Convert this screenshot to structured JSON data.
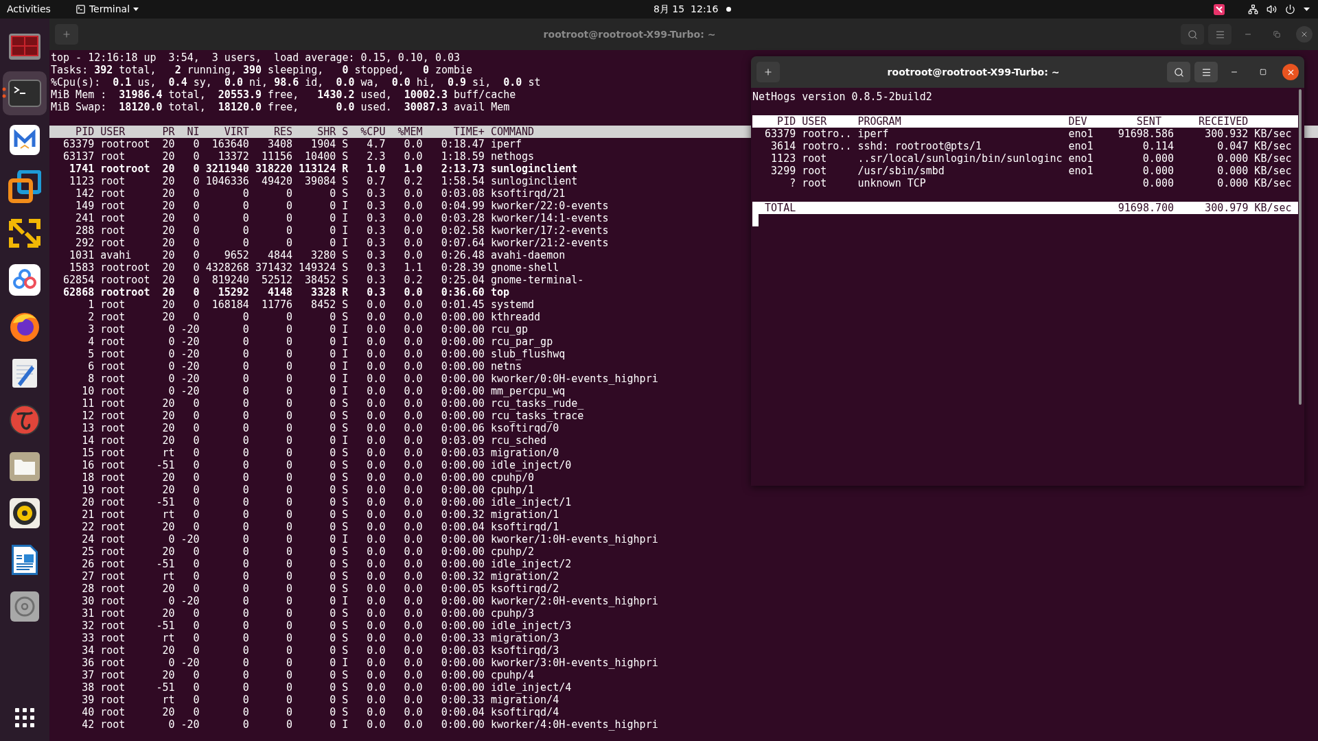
{
  "top_bar": {
    "activities": "Activities",
    "app_menu": "Terminal",
    "clock": "8月 15  12:16"
  },
  "dock": {
    "items": [
      {
        "kind": "workspaces",
        "selected": false,
        "running": false
      },
      {
        "kind": "terminal",
        "selected": true,
        "running": true
      },
      {
        "kind": "mail",
        "selected": false,
        "running": false
      },
      {
        "kind": "boxes",
        "selected": false,
        "running": false
      },
      {
        "kind": "arrows",
        "selected": false,
        "running": false
      },
      {
        "kind": "rings",
        "selected": false,
        "running": false
      },
      {
        "kind": "browser",
        "selected": false,
        "running": false
      },
      {
        "kind": "editor",
        "selected": false,
        "running": false
      },
      {
        "kind": "circle",
        "selected": false,
        "running": false
      },
      {
        "kind": "folder",
        "selected": false,
        "running": false
      },
      {
        "kind": "speaker",
        "selected": false,
        "running": false
      },
      {
        "kind": "document",
        "selected": false,
        "running": false
      },
      {
        "kind": "disc",
        "selected": false,
        "running": false
      }
    ]
  },
  "main_window": {
    "title": "rootroot@rootroot-X99-Turbo: ~",
    "active": false,
    "summary_lines": [
      "top - 12:16:18 up  3:54,  3 users,  load average: 0.15, 0.10, 0.03",
      "Tasks: **392** total,   **2** running, **390** sleeping,   **0** stopped,   **0** zombie",
      "%Cpu(s):  **0.1** us,  **0.4** sy,  **0.0** ni, **98.6** id,  **0.0** wa,  **0.0** hi,  **0.9** si,  **0.0** st",
      "MiB Mem :  **31986.4** total,  **20553.9** free,   **1430.2** used,  **10002.3** buff/cache",
      "MiB Swap:  **18120.0** total,  **18120.0** free,      **0.0** used.  **30087.3** avail Mem"
    ],
    "table": {
      "columns": [
        "PID",
        "USER",
        "PR",
        "NI",
        "VIRT",
        "RES",
        "SHR",
        "S",
        "%CPU",
        "%MEM",
        "TIME+",
        "COMMAND"
      ],
      "rows": [
        {
          "bold": false,
          "cells": [
            "63379",
            "rootroot",
            "20",
            "0",
            "163640",
            "3408",
            "1904",
            "S",
            "4.7",
            "0.0",
            "0:18.47",
            "iperf"
          ]
        },
        {
          "bold": false,
          "cells": [
            "63137",
            "root",
            "20",
            "0",
            "13372",
            "11156",
            "10400",
            "S",
            "2.3",
            "0.0",
            "1:18.59",
            "nethogs"
          ]
        },
        {
          "bold": true,
          "cells": [
            "1741",
            "rootroot",
            "20",
            "0",
            "3211940",
            "318220",
            "113124",
            "R",
            "1.0",
            "1.0",
            "2:13.73",
            "sunloginclient"
          ]
        },
        {
          "bold": false,
          "cells": [
            "1123",
            "root",
            "20",
            "0",
            "1046336",
            "49420",
            "39084",
            "S",
            "0.7",
            "0.2",
            "1:58.54",
            "sunloginclient"
          ]
        },
        {
          "bold": false,
          "cells": [
            "142",
            "root",
            "20",
            "0",
            "0",
            "0",
            "0",
            "S",
            "0.3",
            "0.0",
            "0:03.08",
            "ksoftirqd/21"
          ]
        },
        {
          "bold": false,
          "cells": [
            "149",
            "root",
            "20",
            "0",
            "0",
            "0",
            "0",
            "I",
            "0.3",
            "0.0",
            "0:04.99",
            "kworker/22:0-events"
          ]
        },
        {
          "bold": false,
          "cells": [
            "241",
            "root",
            "20",
            "0",
            "0",
            "0",
            "0",
            "I",
            "0.3",
            "0.0",
            "0:03.28",
            "kworker/14:1-events"
          ]
        },
        {
          "bold": false,
          "cells": [
            "288",
            "root",
            "20",
            "0",
            "0",
            "0",
            "0",
            "I",
            "0.3",
            "0.0",
            "0:02.58",
            "kworker/17:2-events"
          ]
        },
        {
          "bold": false,
          "cells": [
            "292",
            "root",
            "20",
            "0",
            "0",
            "0",
            "0",
            "I",
            "0.3",
            "0.0",
            "0:07.64",
            "kworker/21:2-events"
          ]
        },
        {
          "bold": false,
          "cells": [
            "1031",
            "avahi",
            "20",
            "0",
            "9652",
            "4844",
            "3280",
            "S",
            "0.3",
            "0.0",
            "0:26.48",
            "avahi-daemon"
          ]
        },
        {
          "bold": false,
          "cells": [
            "1583",
            "rootroot",
            "20",
            "0",
            "4328268",
            "371432",
            "149324",
            "S",
            "0.3",
            "1.1",
            "0:28.39",
            "gnome-shell"
          ]
        },
        {
          "bold": false,
          "cells": [
            "62854",
            "rootroot",
            "20",
            "0",
            "819240",
            "52512",
            "38452",
            "S",
            "0.3",
            "0.2",
            "0:25.04",
            "gnome-terminal-"
          ]
        },
        {
          "bold": true,
          "cells": [
            "62868",
            "rootroot",
            "20",
            "0",
            "15292",
            "4148",
            "3328",
            "R",
            "0.3",
            "0.0",
            "0:36.60",
            "top"
          ]
        },
        {
          "bold": false,
          "cells": [
            "1",
            "root",
            "20",
            "0",
            "168184",
            "11776",
            "8452",
            "S",
            "0.0",
            "0.0",
            "0:01.45",
            "systemd"
          ]
        },
        {
          "bold": false,
          "cells": [
            "2",
            "root",
            "20",
            "0",
            "0",
            "0",
            "0",
            "S",
            "0.0",
            "0.0",
            "0:00.00",
            "kthreadd"
          ]
        },
        {
          "bold": false,
          "cells": [
            "3",
            "root",
            "0",
            "-20",
            "0",
            "0",
            "0",
            "I",
            "0.0",
            "0.0",
            "0:00.00",
            "rcu_gp"
          ]
        },
        {
          "bold": false,
          "cells": [
            "4",
            "root",
            "0",
            "-20",
            "0",
            "0",
            "0",
            "I",
            "0.0",
            "0.0",
            "0:00.00",
            "rcu_par_gp"
          ]
        },
        {
          "bold": false,
          "cells": [
            "5",
            "root",
            "0",
            "-20",
            "0",
            "0",
            "0",
            "I",
            "0.0",
            "0.0",
            "0:00.00",
            "slub_flushwq"
          ]
        },
        {
          "bold": false,
          "cells": [
            "6",
            "root",
            "0",
            "-20",
            "0",
            "0",
            "0",
            "I",
            "0.0",
            "0.0",
            "0:00.00",
            "netns"
          ]
        },
        {
          "bold": false,
          "cells": [
            "8",
            "root",
            "0",
            "-20",
            "0",
            "0",
            "0",
            "I",
            "0.0",
            "0.0",
            "0:00.00",
            "kworker/0:0H-events_highpri"
          ]
        },
        {
          "bold": false,
          "cells": [
            "10",
            "root",
            "0",
            "-20",
            "0",
            "0",
            "0",
            "I",
            "0.0",
            "0.0",
            "0:00.00",
            "mm_percpu_wq"
          ]
        },
        {
          "bold": false,
          "cells": [
            "11",
            "root",
            "20",
            "0",
            "0",
            "0",
            "0",
            "S",
            "0.0",
            "0.0",
            "0:00.00",
            "rcu_tasks_rude_"
          ]
        },
        {
          "bold": false,
          "cells": [
            "12",
            "root",
            "20",
            "0",
            "0",
            "0",
            "0",
            "S",
            "0.0",
            "0.0",
            "0:00.00",
            "rcu_tasks_trace"
          ]
        },
        {
          "bold": false,
          "cells": [
            "13",
            "root",
            "20",
            "0",
            "0",
            "0",
            "0",
            "S",
            "0.0",
            "0.0",
            "0:00.06",
            "ksoftirqd/0"
          ]
        },
        {
          "bold": false,
          "cells": [
            "14",
            "root",
            "20",
            "0",
            "0",
            "0",
            "0",
            "I",
            "0.0",
            "0.0",
            "0:03.09",
            "rcu_sched"
          ]
        },
        {
          "bold": false,
          "cells": [
            "15",
            "root",
            "rt",
            "0",
            "0",
            "0",
            "0",
            "S",
            "0.0",
            "0.0",
            "0:00.03",
            "migration/0"
          ]
        },
        {
          "bold": false,
          "cells": [
            "16",
            "root",
            "-51",
            "0",
            "0",
            "0",
            "0",
            "S",
            "0.0",
            "0.0",
            "0:00.00",
            "idle_inject/0"
          ]
        },
        {
          "bold": false,
          "cells": [
            "18",
            "root",
            "20",
            "0",
            "0",
            "0",
            "0",
            "S",
            "0.0",
            "0.0",
            "0:00.00",
            "cpuhp/0"
          ]
        },
        {
          "bold": false,
          "cells": [
            "19",
            "root",
            "20",
            "0",
            "0",
            "0",
            "0",
            "S",
            "0.0",
            "0.0",
            "0:00.00",
            "cpuhp/1"
          ]
        },
        {
          "bold": false,
          "cells": [
            "20",
            "root",
            "-51",
            "0",
            "0",
            "0",
            "0",
            "S",
            "0.0",
            "0.0",
            "0:00.00",
            "idle_inject/1"
          ]
        },
        {
          "bold": false,
          "cells": [
            "21",
            "root",
            "rt",
            "0",
            "0",
            "0",
            "0",
            "S",
            "0.0",
            "0.0",
            "0:00.32",
            "migration/1"
          ]
        },
        {
          "bold": false,
          "cells": [
            "22",
            "root",
            "20",
            "0",
            "0",
            "0",
            "0",
            "S",
            "0.0",
            "0.0",
            "0:00.04",
            "ksoftirqd/1"
          ]
        },
        {
          "bold": false,
          "cells": [
            "24",
            "root",
            "0",
            "-20",
            "0",
            "0",
            "0",
            "I",
            "0.0",
            "0.0",
            "0:00.00",
            "kworker/1:0H-events_highpri"
          ]
        },
        {
          "bold": false,
          "cells": [
            "25",
            "root",
            "20",
            "0",
            "0",
            "0",
            "0",
            "S",
            "0.0",
            "0.0",
            "0:00.00",
            "cpuhp/2"
          ]
        },
        {
          "bold": false,
          "cells": [
            "26",
            "root",
            "-51",
            "0",
            "0",
            "0",
            "0",
            "S",
            "0.0",
            "0.0",
            "0:00.00",
            "idle_inject/2"
          ]
        },
        {
          "bold": false,
          "cells": [
            "27",
            "root",
            "rt",
            "0",
            "0",
            "0",
            "0",
            "S",
            "0.0",
            "0.0",
            "0:00.32",
            "migration/2"
          ]
        },
        {
          "bold": false,
          "cells": [
            "28",
            "root",
            "20",
            "0",
            "0",
            "0",
            "0",
            "S",
            "0.0",
            "0.0",
            "0:00.05",
            "ksoftirqd/2"
          ]
        },
        {
          "bold": false,
          "cells": [
            "30",
            "root",
            "0",
            "-20",
            "0",
            "0",
            "0",
            "I",
            "0.0",
            "0.0",
            "0:00.00",
            "kworker/2:0H-events_highpri"
          ]
        },
        {
          "bold": false,
          "cells": [
            "31",
            "root",
            "20",
            "0",
            "0",
            "0",
            "0",
            "S",
            "0.0",
            "0.0",
            "0:00.00",
            "cpuhp/3"
          ]
        },
        {
          "bold": false,
          "cells": [
            "32",
            "root",
            "-51",
            "0",
            "0",
            "0",
            "0",
            "S",
            "0.0",
            "0.0",
            "0:00.00",
            "idle_inject/3"
          ]
        },
        {
          "bold": false,
          "cells": [
            "33",
            "root",
            "rt",
            "0",
            "0",
            "0",
            "0",
            "S",
            "0.0",
            "0.0",
            "0:00.33",
            "migration/3"
          ]
        },
        {
          "bold": false,
          "cells": [
            "34",
            "root",
            "20",
            "0",
            "0",
            "0",
            "0",
            "S",
            "0.0",
            "0.0",
            "0:00.03",
            "ksoftirqd/3"
          ]
        },
        {
          "bold": false,
          "cells": [
            "36",
            "root",
            "0",
            "-20",
            "0",
            "0",
            "0",
            "I",
            "0.0",
            "0.0",
            "0:00.00",
            "kworker/3:0H-events_highpri"
          ]
        },
        {
          "bold": false,
          "cells": [
            "37",
            "root",
            "20",
            "0",
            "0",
            "0",
            "0",
            "S",
            "0.0",
            "0.0",
            "0:00.00",
            "cpuhp/4"
          ]
        },
        {
          "bold": false,
          "cells": [
            "38",
            "root",
            "-51",
            "0",
            "0",
            "0",
            "0",
            "S",
            "0.0",
            "0.0",
            "0:00.00",
            "idle_inject/4"
          ]
        },
        {
          "bold": false,
          "cells": [
            "39",
            "root",
            "rt",
            "0",
            "0",
            "0",
            "0",
            "S",
            "0.0",
            "0.0",
            "0:00.33",
            "migration/4"
          ]
        },
        {
          "bold": false,
          "cells": [
            "40",
            "root",
            "20",
            "0",
            "0",
            "0",
            "0",
            "S",
            "0.0",
            "0.0",
            "0:00.04",
            "ksoftirqd/4"
          ]
        },
        {
          "bold": false,
          "cells": [
            "42",
            "root",
            "0",
            "-20",
            "0",
            "0",
            "0",
            "I",
            "0.0",
            "0.0",
            "0:00.00",
            "kworker/4:0H-events_highpri"
          ]
        }
      ]
    }
  },
  "nethogs_window": {
    "title": "rootroot@rootroot-X99-Turbo: ~",
    "active": true,
    "version_line": "NetHogs version 0.8.5-2build2",
    "table": {
      "columns": [
        "PID",
        "USER",
        "PROGRAM",
        "DEV",
        "SENT",
        "RECEIVED"
      ],
      "rows": [
        {
          "pid": "63379",
          "user": "rootro..",
          "program": "iperf",
          "dev": "eno1",
          "sent": "91698.586",
          "received": "300.932",
          "unit": "KB/sec"
        },
        {
          "pid": "3614",
          "user": "rootro..",
          "program": "sshd: rootroot@pts/1",
          "dev": "eno1",
          "sent": "0.114",
          "received": "0.047",
          "unit": "KB/sec"
        },
        {
          "pid": "1123",
          "user": "root",
          "program": "..sr/local/sunlogin/bin/sunloginc",
          "dev": "eno1",
          "sent": "0.000",
          "received": "0.000",
          "unit": "KB/sec"
        },
        {
          "pid": "3299",
          "user": "root",
          "program": "/usr/sbin/smbd",
          "dev": "eno1",
          "sent": "0.000",
          "received": "0.000",
          "unit": "KB/sec"
        },
        {
          "pid": "?",
          "user": "root",
          "program": "unknown TCP",
          "sent": "0.000",
          "received": "0.000",
          "unit": "KB/sec"
        }
      ]
    },
    "total": {
      "label": "TOTAL",
      "sent": "91698.700",
      "received": "300.979",
      "unit": "KB/sec"
    }
  }
}
